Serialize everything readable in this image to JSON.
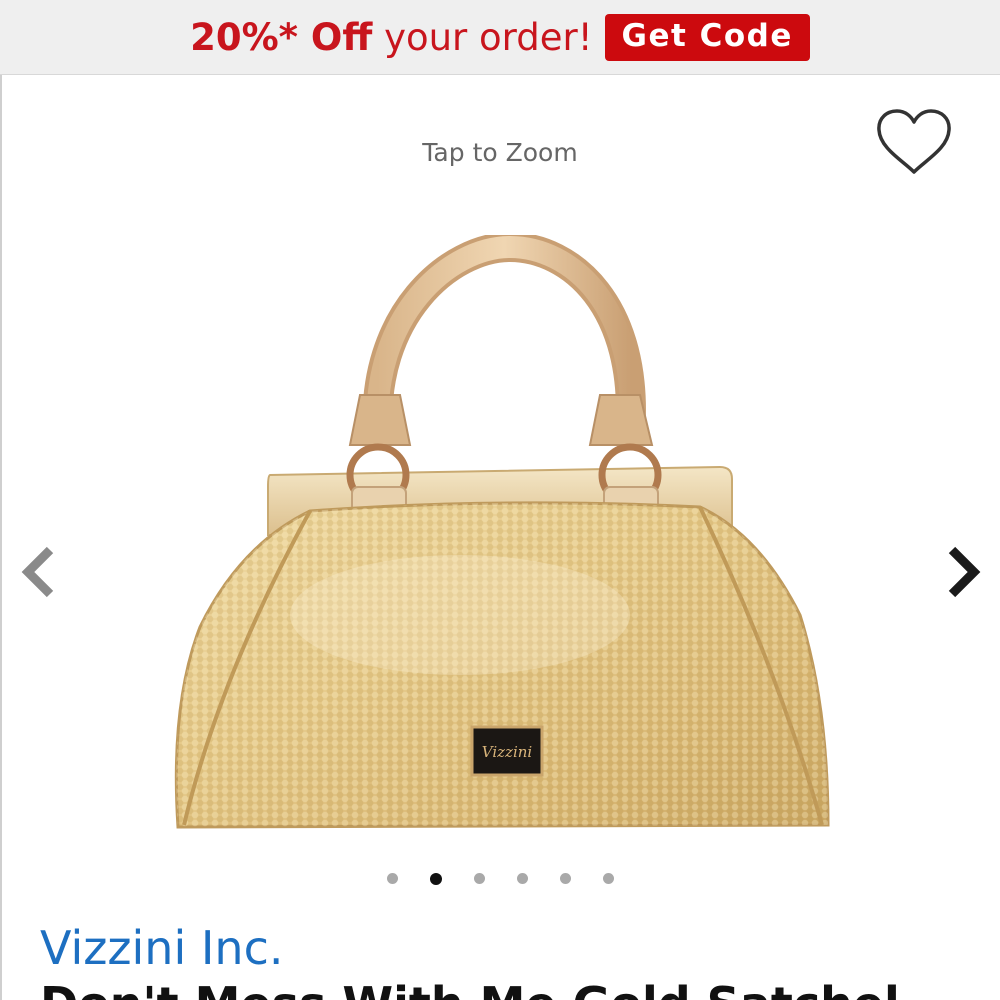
{
  "promo": {
    "headline_strong": "20%* Off",
    "headline_rest": "your order!",
    "button_label": "Get Code"
  },
  "gallery": {
    "zoom_hint": "Tap to Zoom",
    "prev_icon": "chevron-left-icon",
    "next_icon": "chevron-right-icon",
    "favorite_icon": "heart-outline-icon",
    "slide_count": 6,
    "active_slide": 2,
    "logo_plate_text": "Vizzini"
  },
  "product": {
    "brand": "Vizzini Inc.",
    "title": "Don't Mess With Me Gold Satchel"
  },
  "colors": {
    "promo_red": "#c8151d",
    "button_red": "#cc0a0e",
    "brand_blue": "#1d6fc1"
  }
}
